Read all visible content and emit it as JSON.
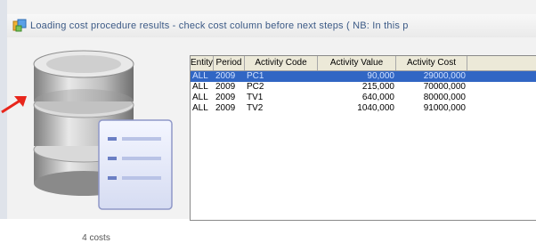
{
  "window": {
    "title": "Loading cost procedure results - check cost column before next steps ( NB: In this p"
  },
  "left_panel": {
    "caption": "4 costs"
  },
  "grid": {
    "columns": [
      "Entity",
      "Period",
      "Activity Code",
      "Activity Value",
      "Activity Cost"
    ],
    "rows": [
      {
        "entity": "ALL",
        "period": "2009",
        "code": "PC1",
        "value": "90,000",
        "cost": "29000,000",
        "selected": true
      },
      {
        "entity": "ALL",
        "period": "2009",
        "code": "PC2",
        "value": "215,000",
        "cost": "70000,000",
        "selected": false
      },
      {
        "entity": "ALL",
        "period": "2009",
        "code": "TV1",
        "value": "640,000",
        "cost": "80000,000",
        "selected": false
      },
      {
        "entity": "ALL",
        "period": "2009",
        "code": "TV2",
        "value": "1040,000",
        "cost": "91000,000",
        "selected": false
      }
    ]
  },
  "colors": {
    "selection": "#3166c4",
    "title_text": "#3c5a86",
    "arrow": "#e8261b"
  }
}
